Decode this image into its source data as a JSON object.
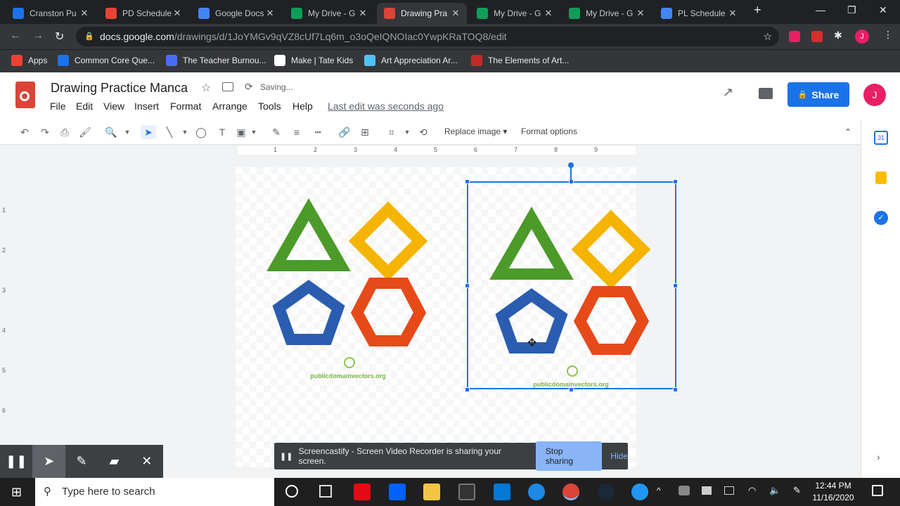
{
  "browser": {
    "tabs": [
      {
        "title": "Cranston Pu",
        "icon": "cranston-icon",
        "color": "#1a73e8"
      },
      {
        "title": "PD Schedule",
        "icon": "gmail-icon",
        "color": "#ea4335"
      },
      {
        "title": "Google Docs",
        "icon": "docs-icon",
        "color": "#4285f4"
      },
      {
        "title": "My Drive - G",
        "icon": "drive-icon",
        "color": "#0f9d58"
      },
      {
        "title": "Drawing Pra",
        "icon": "drawings-icon",
        "color": "#db4437"
      },
      {
        "title": "My Drive - G",
        "icon": "drive-icon",
        "color": "#0f9d58"
      },
      {
        "title": "My Drive - G",
        "icon": "drive-icon",
        "color": "#0f9d58"
      },
      {
        "title": "PL Schedule",
        "icon": "docs-icon",
        "color": "#4285f4"
      }
    ],
    "active_tab": 4,
    "url_host": "docs.google.com",
    "url_path": "/drawings/d/1JoYMGv9qVZ8cUf7Lq6m_o3oQeIQNOIac0YwpKRaTOQ8/edit",
    "bookmarks": [
      {
        "label": "Apps",
        "icon": "apps-grid-icon",
        "color": "#ea4335"
      },
      {
        "label": "Common Core Que...",
        "icon": "t-icon",
        "color": "#1a73e8"
      },
      {
        "label": "The Teacher Burnou...",
        "icon": "pt-icon",
        "color": "#4a6cf7"
      },
      {
        "label": "Make | Tate Kids",
        "icon": "tate-icon",
        "color": "#ffffff"
      },
      {
        "label": "Art Appreciation Ar...",
        "icon": "globe-icon",
        "color": "#4fc3f7"
      },
      {
        "label": "The Elements of Art...",
        "icon": "bookmark-icon",
        "color": "#c62828"
      }
    ]
  },
  "app": {
    "title": "Drawing Practice Manca",
    "status": "Saving...",
    "last_edit": "Last edit was seconds ago",
    "menus": [
      "File",
      "Edit",
      "View",
      "Insert",
      "Format",
      "Arrange",
      "Tools",
      "Help"
    ],
    "share_label": "Share",
    "avatar_letter": "J"
  },
  "toolbar": {
    "replace_image": "Replace image",
    "format_options": "Format options"
  },
  "ruler": {
    "h_ticks": [
      "1",
      "2",
      "3",
      "4",
      "5",
      "6",
      "7",
      "8",
      "9"
    ],
    "v_ticks": [
      "1",
      "2",
      "3",
      "4",
      "5",
      "6"
    ]
  },
  "canvas": {
    "images": [
      {
        "watermark": "publicdomainvectors.org"
      },
      {
        "watermark": "publicdomainvectors.org"
      }
    ]
  },
  "screencastify": {
    "banner_text": "Screencastify - Screen Video Recorder is sharing your screen.",
    "stop_label": "Stop sharing",
    "hide_label": "Hide"
  },
  "taskbar": {
    "search_placeholder": "Type here to search",
    "time": "12:44 PM",
    "date": "11/16/2020"
  }
}
